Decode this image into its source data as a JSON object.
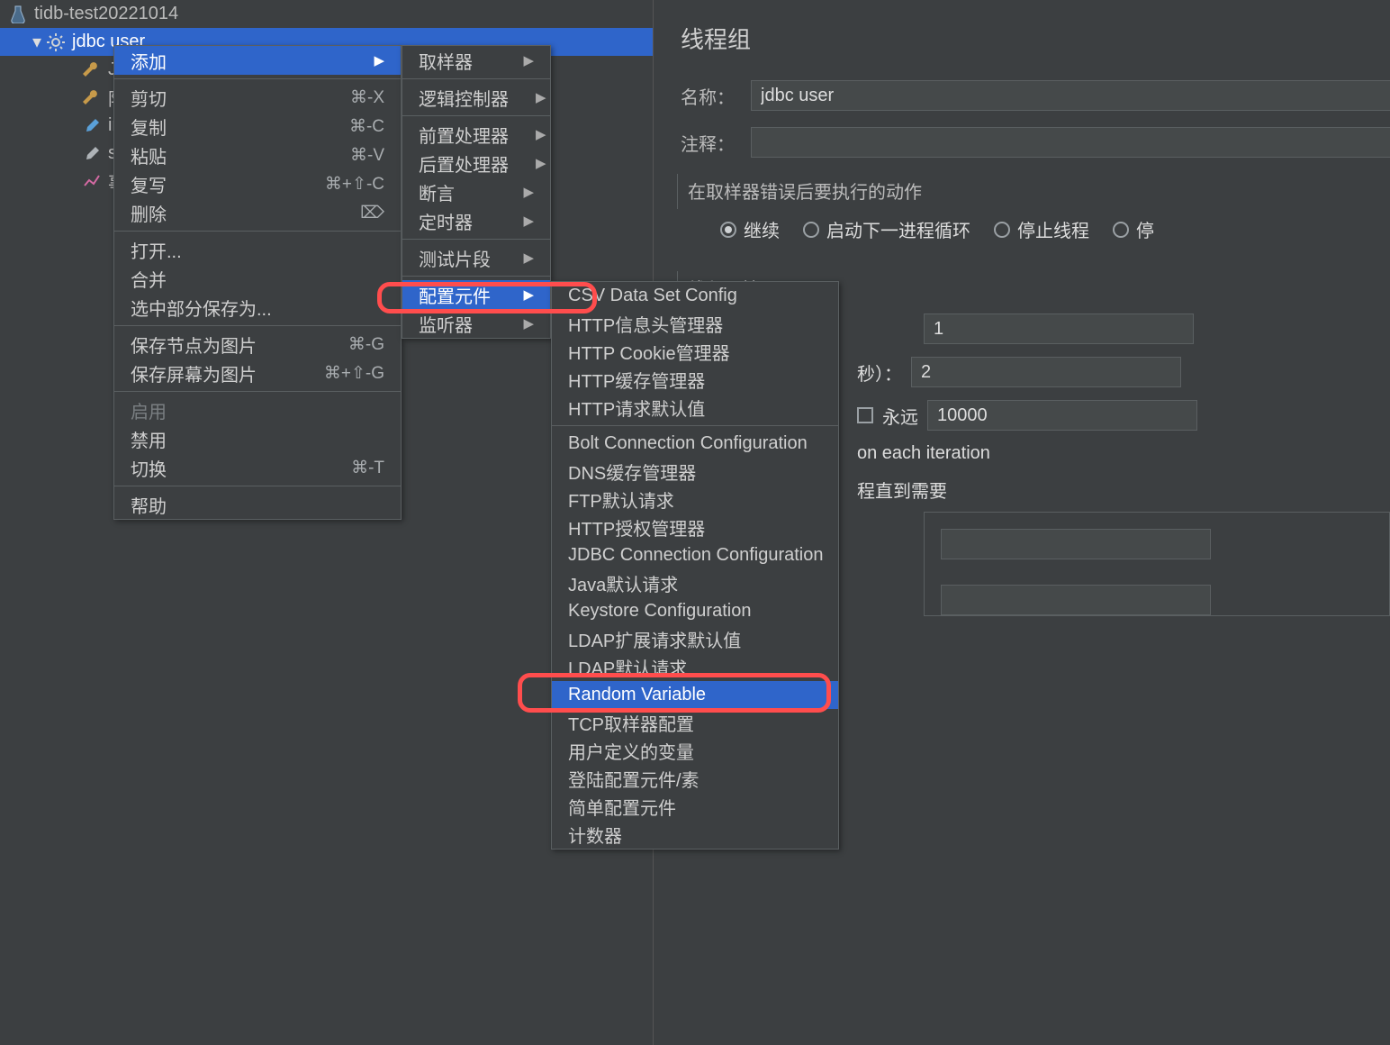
{
  "tree": {
    "root": "tidb-test20221014",
    "items": [
      "jdbc user",
      "J",
      "陀",
      "ir",
      "st",
      "事"
    ]
  },
  "form": {
    "title": "线程组",
    "name_label": "名称：",
    "name_value": "jdbc user",
    "comment_label": "注释：",
    "comment_value": "",
    "onerror_title": "在取样器错误后要执行的动作",
    "radios": [
      "继续",
      "启动下一进程循环",
      "停止线程",
      "停"
    ],
    "props_title": "线程属性",
    "threads_value": "1",
    "ramp_label": "秒）：",
    "ramp_value": "2",
    "forever_label": "永远",
    "loop_value": "10000",
    "each_iter": "on each iteration",
    "until_needed": "程直到需要"
  },
  "menu1": {
    "items": [
      {
        "t": "添加",
        "k": "",
        "arrow": true,
        "sel": true
      },
      {
        "sep": true
      },
      {
        "t": "剪切",
        "k": "⌘-X"
      },
      {
        "t": "复制",
        "k": "⌘-C"
      },
      {
        "t": "粘贴",
        "k": "⌘-V"
      },
      {
        "t": "复写",
        "k": "⌘+⇧-C"
      },
      {
        "t": "删除",
        "k": "⌦"
      },
      {
        "sep": true
      },
      {
        "t": "打开..."
      },
      {
        "t": "合并"
      },
      {
        "t": "选中部分保存为..."
      },
      {
        "sep": true
      },
      {
        "t": "保存节点为图片",
        "k": "⌘-G"
      },
      {
        "t": "保存屏幕为图片",
        "k": "⌘+⇧-G"
      },
      {
        "sep": true
      },
      {
        "t": "启用",
        "disabled": true
      },
      {
        "t": "禁用"
      },
      {
        "t": "切换",
        "k": "⌘-T"
      },
      {
        "sep": true
      },
      {
        "t": "帮助"
      }
    ]
  },
  "menu2": {
    "items": [
      {
        "t": "取样器",
        "arrow": true
      },
      {
        "sep": true
      },
      {
        "t": "逻辑控制器",
        "arrow": true
      },
      {
        "sep": true
      },
      {
        "t": "前置处理器",
        "arrow": true
      },
      {
        "t": "后置处理器",
        "arrow": true
      },
      {
        "t": "断言",
        "arrow": true
      },
      {
        "t": "定时器",
        "arrow": true
      },
      {
        "sep": true
      },
      {
        "t": "测试片段",
        "arrow": true
      },
      {
        "sep": true
      },
      {
        "t": "配置元件",
        "arrow": true,
        "sel": true
      },
      {
        "t": "监听器",
        "arrow": true
      }
    ]
  },
  "menu3": {
    "items": [
      {
        "t": "CSV Data Set Config"
      },
      {
        "t": "HTTP信息头管理器"
      },
      {
        "t": "HTTP Cookie管理器"
      },
      {
        "t": "HTTP缓存管理器"
      },
      {
        "t": "HTTP请求默认值"
      },
      {
        "sep": true
      },
      {
        "t": "Bolt Connection Configuration"
      },
      {
        "t": "DNS缓存管理器"
      },
      {
        "t": "FTP默认请求"
      },
      {
        "t": "HTTP授权管理器"
      },
      {
        "t": "JDBC Connection Configuration"
      },
      {
        "t": "Java默认请求"
      },
      {
        "t": "Keystore Configuration"
      },
      {
        "t": "LDAP扩展请求默认值"
      },
      {
        "t": "LDAP默认请求"
      },
      {
        "t": "Random Variable",
        "sel": true
      },
      {
        "t": "TCP取样器配置"
      },
      {
        "t": "用户定义的变量"
      },
      {
        "t": "登陆配置元件/素"
      },
      {
        "t": "简单配置元件"
      },
      {
        "t": "计数器"
      }
    ]
  }
}
